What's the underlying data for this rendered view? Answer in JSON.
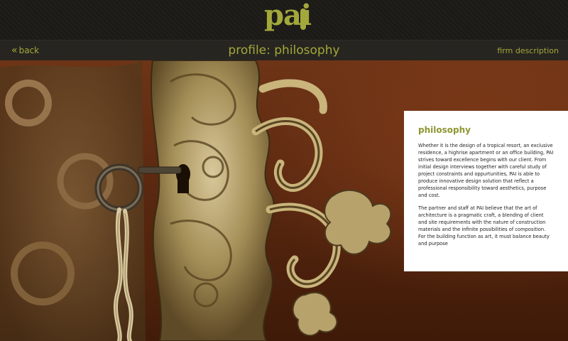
{
  "header": {
    "logo_text": "pai",
    "back_label": "back",
    "title": "profile: philosophy",
    "firm_description_label": "firm description"
  },
  "panel": {
    "heading": "philosophy",
    "paragraphs": [
      "Whether it is the design of a tropical resort, an exclusive residence, a highrise apartment or an office building, PAI strives toward excellence begins with our client. From initial design interviews together with careful study of project constraints and oppurtunities, PAI is able to produce innovative design solution that reflect a professional responsibility toward aesthetics, purpose and cost.",
      "The partner and staff at PAI believe that the art of architecture is a pragmatic craft, a blending of client and site requirements with the nature of construction materials and the infinite possibilities of composition. For the building function as art, it must balance beauty and purpose"
    ]
  },
  "colors": {
    "accent": "#a3a83a",
    "header_bg": "#1c1a17",
    "panel_bg": "#ffffff",
    "heading_color": "#8d9630"
  },
  "icons": {
    "back": "double-chevron-left-icon"
  },
  "background_image": {
    "subject": "ornate brass lock plate with key and tassel on wood"
  }
}
